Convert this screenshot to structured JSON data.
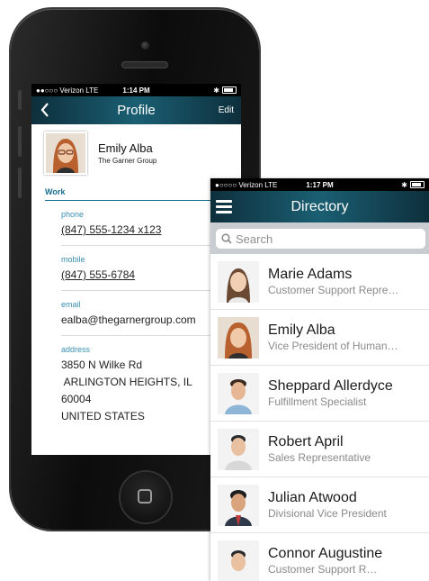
{
  "profile_screen": {
    "status": {
      "carrier": "●●○○○ Verizon  LTE",
      "time": "1:14 PM",
      "bluetooth": "✱"
    },
    "nav": {
      "title": "Profile",
      "edit_label": "Edit",
      "back_icon": "chevron-left-icon"
    },
    "person": {
      "name": "Emily Alba",
      "company": "The Garner Group"
    },
    "section": "Work",
    "fields": [
      {
        "label": "phone",
        "value": "(847) 555-1234 x123"
      },
      {
        "label": "mobile",
        "value": "(847) 555-6784"
      },
      {
        "label": "email",
        "value": "ealba@thegarnergroup.com"
      }
    ],
    "address": {
      "label": "address",
      "lines": [
        "3850 N Wilke Rd",
        " ARLINGTON HEIGHTS, IL",
        "60004",
        "UNITED STATES"
      ]
    }
  },
  "directory_screen": {
    "status": {
      "carrier": "●○○○○ Verizon  LTE",
      "time": "1:17 PM",
      "bluetooth": "✱"
    },
    "nav": {
      "title": "Directory",
      "menu_icon": "hamburger-menu-icon"
    },
    "search": {
      "placeholder": "Search",
      "icon": "search-icon"
    },
    "contacts": [
      {
        "name": "Marie Adams",
        "title": "Customer Support Repre…"
      },
      {
        "name": "Emily Alba",
        "title": "Vice President of Human…"
      },
      {
        "name": "Sheppard Allerdyce",
        "title": "Fulfillment Specialist"
      },
      {
        "name": "Robert April",
        "title": "Sales Representative"
      },
      {
        "name": "Julian Atwood",
        "title": "Divisional Vice President"
      },
      {
        "name": "Connor Augustine",
        "title": "Customer Support R…"
      }
    ]
  },
  "colors": {
    "navbar_dark": "#0e2f3c",
    "navbar_mid": "#1a5f73",
    "accent": "#1a6e8f",
    "label": "#3a8fb2"
  }
}
